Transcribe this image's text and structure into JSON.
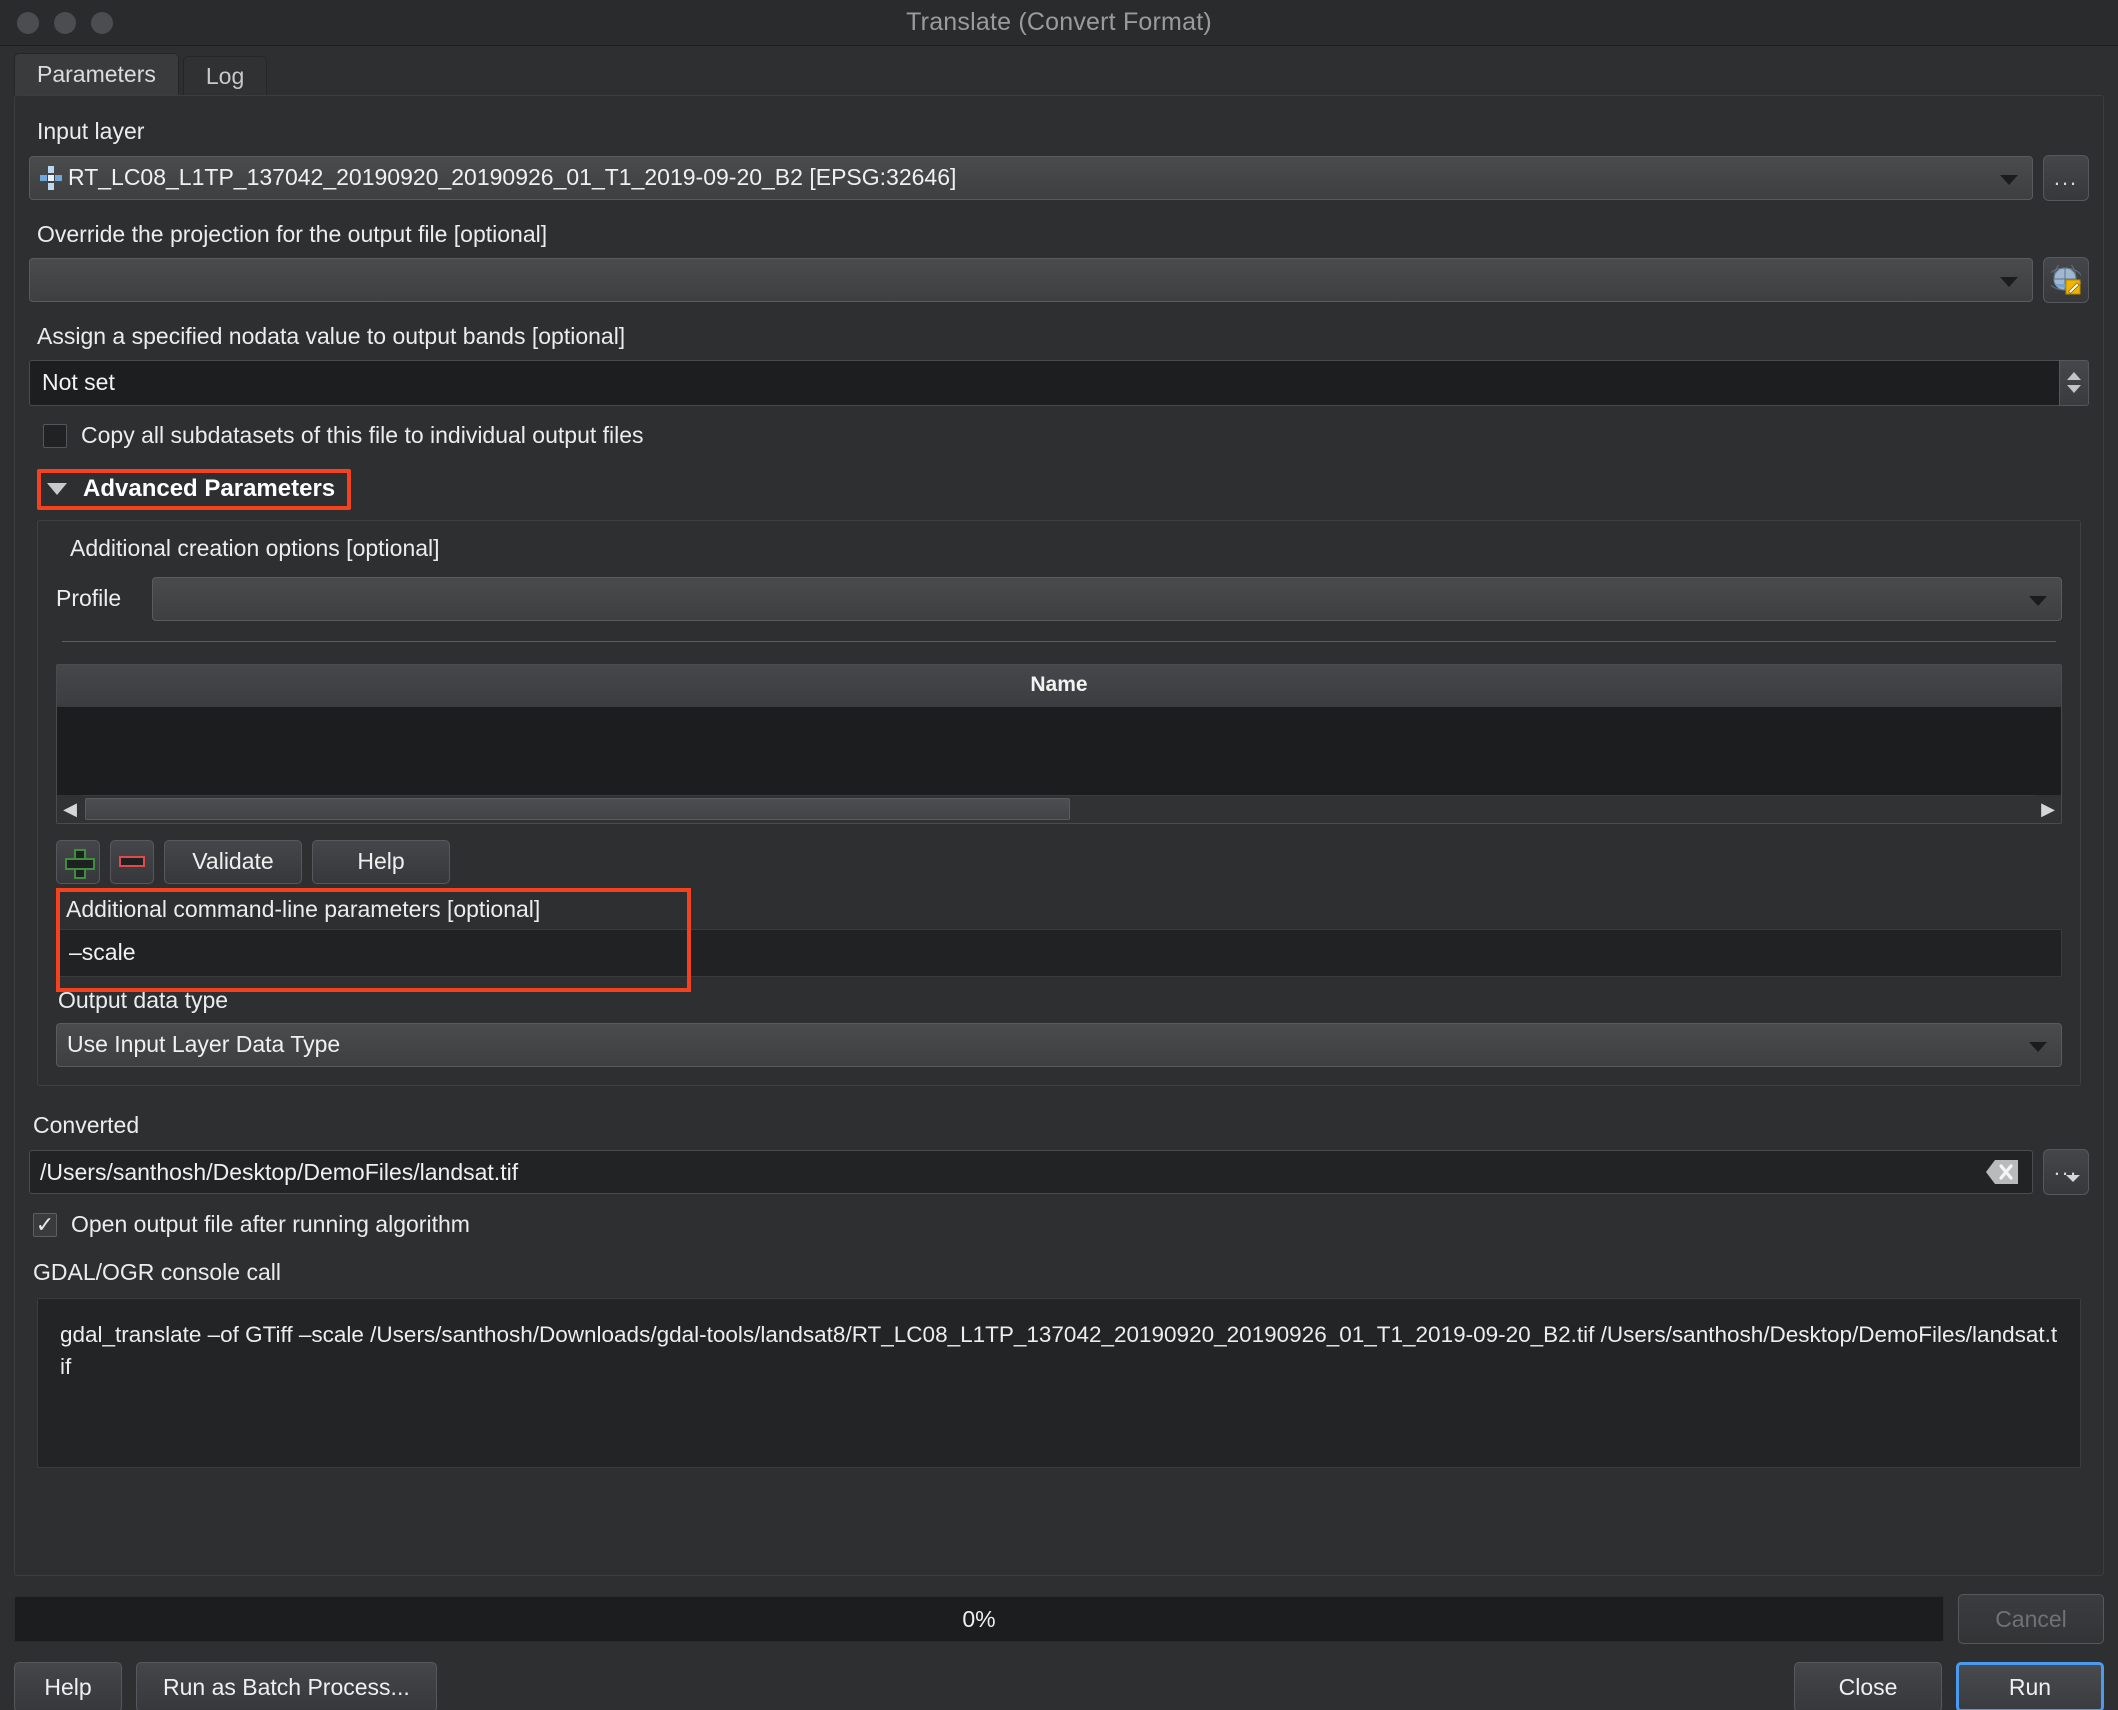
{
  "window": {
    "title": "Translate (Convert Format)",
    "traffic_lights": [
      "close-button",
      "minimize-button",
      "zoom-button"
    ]
  },
  "tabs": [
    {
      "label": "Parameters",
      "active": true
    },
    {
      "label": "Log",
      "active": false
    }
  ],
  "parameters": {
    "input_layer": {
      "label": "Input layer",
      "value": "RT_LC08_L1TP_137042_20190920_20190926_01_T1_2019-09-20_B2 [EPSG:32646]",
      "browse_label": "...",
      "icon": "raster-layer-icon"
    },
    "override_projection": {
      "label": "Override the projection for the output file [optional]",
      "value": "",
      "crs_icon": "crs-globe-pencil-icon"
    },
    "nodata": {
      "label": "Assign a specified nodata value to output bands [optional]",
      "value": "Not set"
    },
    "copy_subdatasets": {
      "label": "Copy all subdatasets of this file to individual output files",
      "checked": false
    },
    "advanced": {
      "header": "Advanced Parameters",
      "expanded": true,
      "highlighted": true,
      "creation_options": {
        "label": "Additional creation options [optional]",
        "profile_label": "Profile",
        "profile_value": "",
        "table": {
          "columns": [
            "Name"
          ],
          "rows": []
        },
        "buttons": {
          "add": "add-row-button",
          "remove": "remove-row-button",
          "validate": "Validate",
          "help": "Help"
        }
      },
      "extra_cli": {
        "label": "Additional command-line parameters [optional]",
        "value": "–scale",
        "highlighted": true
      },
      "output_data_type": {
        "label": "Output data type",
        "value": "Use Input Layer Data Type"
      }
    }
  },
  "output": {
    "label": "Converted",
    "path": "/Users/santhosh/Desktop/DemoFiles/landsat.tif",
    "clear_icon": "clear-backspace-icon",
    "browse_label": "...",
    "open_after_run": {
      "label": "Open output file after running algorithm",
      "checked": true,
      "mark": "✓"
    }
  },
  "console": {
    "label": "GDAL/OGR console call",
    "text": "gdal_translate –of GTiff –scale  /Users/santhosh/Downloads/gdal-tools/landsat8/RT_LC08_L1TP_137042_20190920_20190926_01_T1_2019-09-20_B2.tif /Users/santhosh/Desktop/DemoFiles/landsat.tif"
  },
  "footer": {
    "progress_text": "0%",
    "progress_percent": 0,
    "cancel": "Cancel",
    "help": "Help",
    "batch": "Run as Batch Process...",
    "close": "Close",
    "run": "Run"
  },
  "colors": {
    "highlight": "#f4411e",
    "accent": "#4a9bf0",
    "background": "#2e2f31",
    "field_dark": "#212224"
  }
}
